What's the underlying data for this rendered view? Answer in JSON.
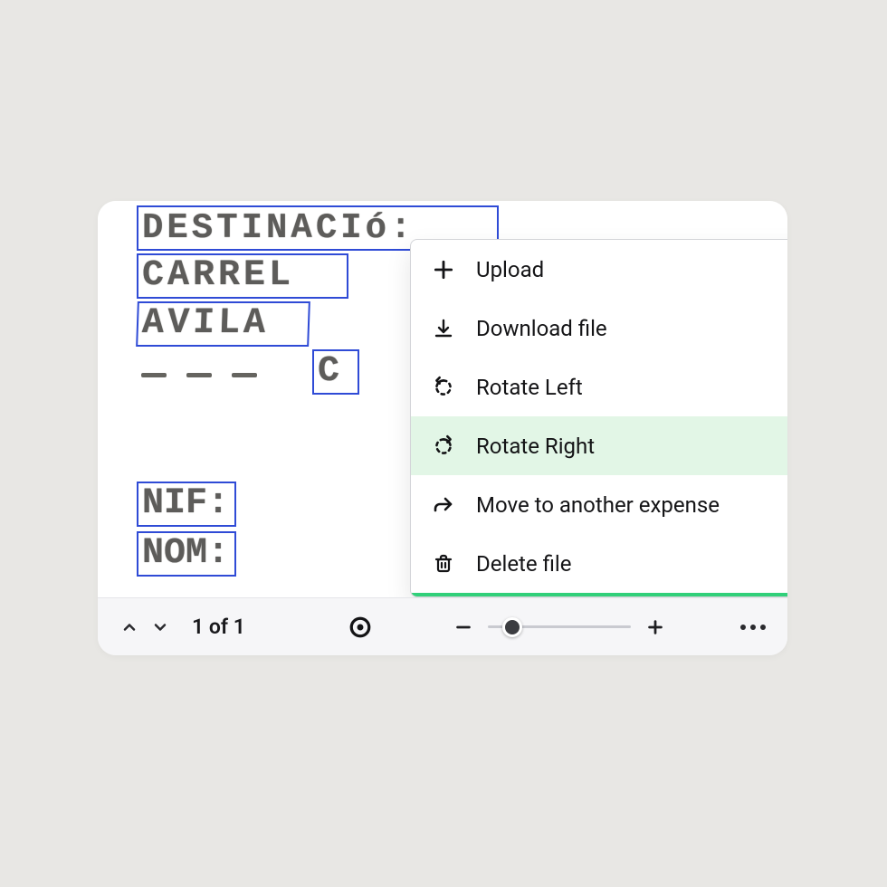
{
  "document": {
    "ocr_boxes": [
      {
        "id": "destinacio",
        "text": "DESTINACIó:"
      },
      {
        "id": "carrel",
        "text": "CARREL"
      },
      {
        "id": "avila",
        "text": "AVILA"
      },
      {
        "id": "smallC",
        "text": "C"
      },
      {
        "id": "nif",
        "text": "NIF:"
      },
      {
        "id": "nom",
        "text": "NOM:"
      }
    ]
  },
  "menu": {
    "items": [
      {
        "id": "upload",
        "label": "Upload",
        "highlight": false
      },
      {
        "id": "download",
        "label": "Download file",
        "highlight": false
      },
      {
        "id": "rotate_left",
        "label": "Rotate Left",
        "highlight": false
      },
      {
        "id": "rotate_right",
        "label": "Rotate Right",
        "highlight": true
      },
      {
        "id": "move",
        "label": "Move to another expense",
        "highlight": false
      },
      {
        "id": "delete",
        "label": "Delete file",
        "highlight": false
      }
    ]
  },
  "toolbar": {
    "page_label": "1 of 1",
    "zoom_slider_percent": 12
  }
}
